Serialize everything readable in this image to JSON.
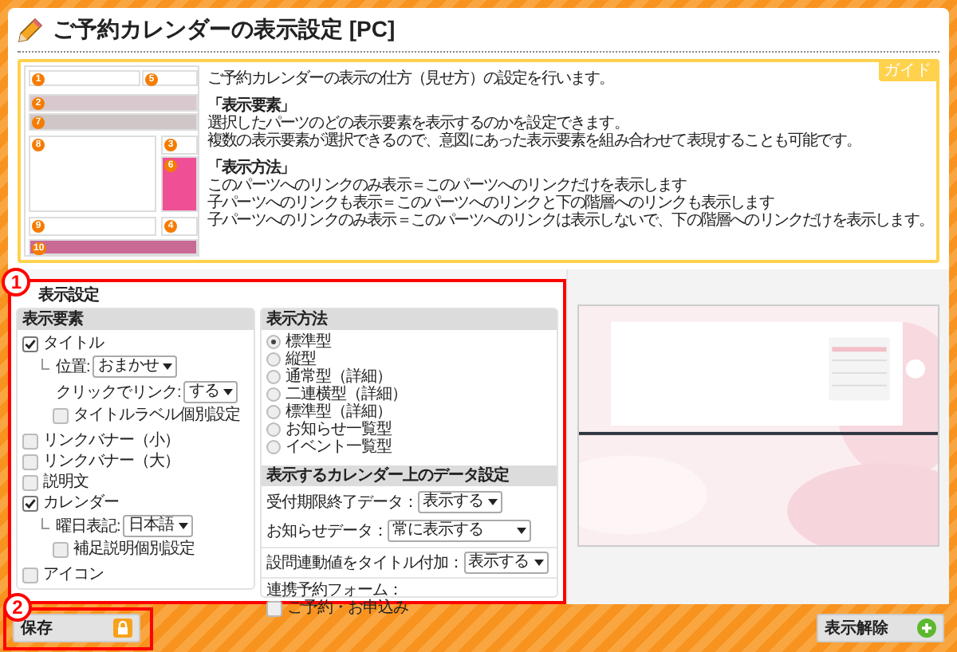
{
  "page_title": "ご予約カレンダーの表示設定 [PC]",
  "guide": {
    "tag": "ガイド",
    "layout_markers": [
      "1",
      "5",
      "2",
      "7",
      "8",
      "3",
      "6",
      "9",
      "4",
      "10"
    ],
    "intro": "ご予約カレンダーの表示の仕方（見せ方）の設定を行います。",
    "sections": [
      {
        "heading": "「表示要素」",
        "lines": [
          "選択したパーツのどの表示要素を表示するのかを設定できます。",
          "複数の表示要素が選択できるので、意図にあった表示要素を組み合わせて表現することも可能です。"
        ]
      },
      {
        "heading": "「表示方法」",
        "lines": [
          "このパーツへのリンクのみ表示＝このパーツへのリンクだけを表示します",
          "子パーツへのリンクも表示＝このパーツへのリンクと下の階層へのリンクも表示します",
          "子パーツへのリンクのみ表示＝このパーツへのリンクは表示しないで、下の階層へのリンクだけを表示します。"
        ]
      }
    ]
  },
  "settings": {
    "heading": "表示設定",
    "elements": {
      "title": "表示要素",
      "items": [
        {
          "kind": "checkbox",
          "label": "タイトル",
          "checked": true,
          "children": [
            {
              "kind": "select",
              "label": "位置:",
              "value": "おまかせ"
            },
            {
              "kind": "select",
              "label": "クリックでリンク:",
              "value": "する"
            },
            {
              "kind": "checkbox",
              "label": "タイトルラベル個別設定",
              "checked": false
            }
          ]
        },
        {
          "kind": "checkbox",
          "label": "リンクバナー（小）",
          "checked": false
        },
        {
          "kind": "checkbox",
          "label": "リンクバナー（大）",
          "checked": false
        },
        {
          "kind": "checkbox",
          "label": "説明文",
          "checked": false
        },
        {
          "kind": "checkbox",
          "label": "カレンダー",
          "checked": true,
          "children": [
            {
              "kind": "select",
              "label": "曜日表記:",
              "value": "日本語"
            },
            {
              "kind": "checkbox",
              "label": "補足説明個別設定",
              "checked": false
            }
          ]
        },
        {
          "kind": "checkbox",
          "label": "アイコン",
          "checked": false
        }
      ]
    },
    "display_method": {
      "title": "表示方法",
      "options": [
        {
          "label": "標準型",
          "selected": true
        },
        {
          "label": "縦型",
          "selected": false
        },
        {
          "label": "通常型（詳細）",
          "selected": false
        },
        {
          "label": "二連横型（詳細）",
          "selected": false
        },
        {
          "label": "標準型（詳細）",
          "selected": false
        },
        {
          "label": "お知らせ一覧型",
          "selected": false
        },
        {
          "label": "イベント一覧型",
          "selected": false
        }
      ]
    },
    "calendar_data": {
      "title": "表示するカレンダー上のデータ設定",
      "fields": [
        {
          "label": "受付期限終了データ：",
          "value": "表示する"
        },
        {
          "label": "お知らせデータ：",
          "value": "常に表示する"
        }
      ]
    },
    "question_title": {
      "label": "設問連動値をタイトル付加：",
      "value": "表示する"
    },
    "linked_form": {
      "label": "連携予約フォーム：",
      "options": [
        {
          "label": "ご予約・お申込み",
          "checked": false
        }
      ]
    }
  },
  "buttons": {
    "save": "保存",
    "hide": "表示解除"
  },
  "callouts": [
    "1",
    "2"
  ]
}
